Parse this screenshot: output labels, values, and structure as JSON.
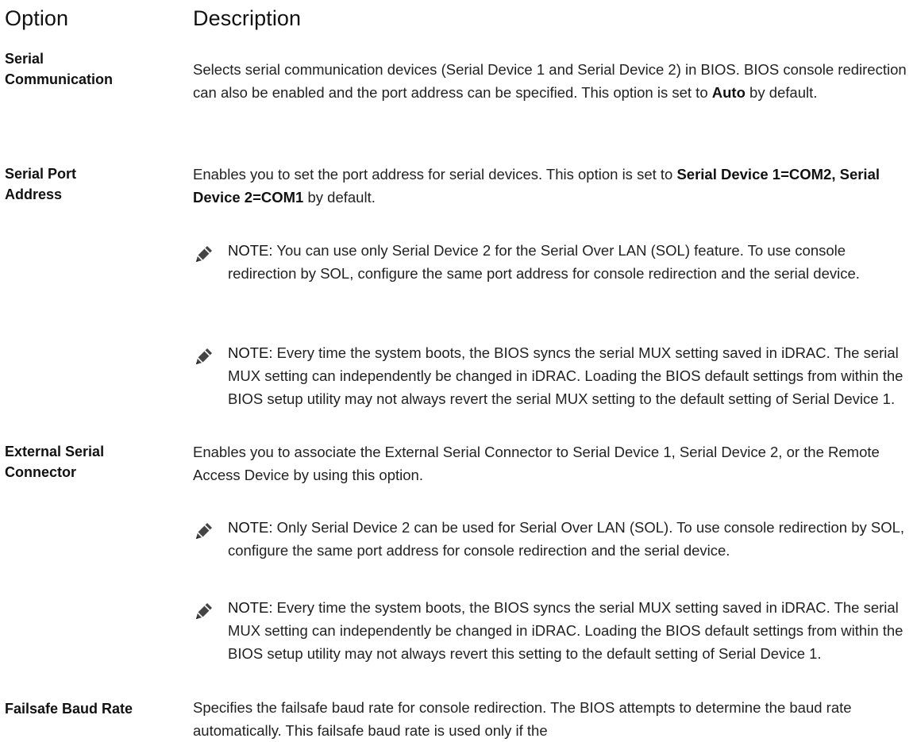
{
  "header": {
    "option": "Option",
    "description": "Description"
  },
  "rows": [
    {
      "label_line1": "Serial",
      "label_line2": "Communication",
      "desc_prefix": "Selects serial communication devices (Serial Device 1 and Serial Device 2) in BIOS. BIOS console redirection can also be enabled and the port address can be specified. This option is set to ",
      "desc_bold": "Auto",
      "desc_suffix": " by default."
    },
    {
      "label_line1": "Serial Port",
      "label_line2": "Address",
      "desc_prefix": "Enables you to set the port address for serial devices. This option is set to ",
      "desc_bold": "Serial Device 1=COM2, Serial Device 2=COM1",
      "desc_suffix": " by default.",
      "notes": [
        {
          "label": "NOTE:",
          "text": " You can use only Serial Device 2 for the Serial Over LAN (SOL) feature. To use console redirection by SOL, configure the same port address for console redirection and the serial device."
        },
        {
          "label": "NOTE:",
          "text": " Every time the system boots, the BIOS syncs the serial MUX setting saved in iDRAC. The serial MUX setting can independently be changed in iDRAC. Loading the BIOS default settings from within the BIOS setup utility may not always revert the serial MUX setting to the default setting of Serial Device 1."
        }
      ]
    },
    {
      "label_line1": "External Serial",
      "label_line2": "Connector",
      "desc": "Enables you to associate the External Serial Connector to Serial Device 1, Serial Device 2, or the Remote Access Device by using this option.",
      "notes": [
        {
          "label": "NOTE:",
          "text": " Only Serial Device 2 can be used for Serial Over LAN (SOL). To use console redirection by SOL, configure the same port address for console redirection and the serial device."
        },
        {
          "label": "NOTE:",
          "text": " Every time the system boots, the BIOS syncs the serial MUX setting saved in iDRAC. The serial MUX setting can independently be changed in iDRAC. Loading the BIOS default settings from within the BIOS setup utility may not always revert this setting to the default setting of Serial Device 1."
        }
      ]
    },
    {
      "label": "Failsafe Baud Rate",
      "desc": "Specifies the failsafe baud rate for console redirection. The BIOS attempts to determine the baud rate automatically. This failsafe baud rate is used only if the"
    }
  ],
  "icons": {
    "note": "pencil-note-icon"
  }
}
